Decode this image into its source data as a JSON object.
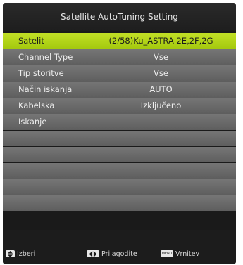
{
  "title": "Satellite AutoTuning Setting",
  "rows": [
    {
      "label": "Satelit",
      "value": "(2/58)Ku_ASTRA 2E,2F,2G",
      "selected": true
    },
    {
      "label": "Channel Type",
      "value": "Vse"
    },
    {
      "label": "Tip storitve",
      "value": "Vse"
    },
    {
      "label": "Način iskanja",
      "value": "AUTO"
    },
    {
      "label": "Kabelska",
      "value": "Izključeno"
    },
    {
      "label": "Iskanje",
      "value": ""
    },
    {
      "label": "",
      "value": ""
    },
    {
      "label": "",
      "value": ""
    },
    {
      "label": "",
      "value": ""
    },
    {
      "label": "",
      "value": ""
    },
    {
      "label": "",
      "value": ""
    }
  ],
  "footer": {
    "select_label": "Izberi",
    "adjust_label": "Prilagodite",
    "menu_key_text": "MENU",
    "back_label": "Vrnitev"
  },
  "colors": {
    "selected_row": "#b3d41a",
    "row_bg": "#6b6b6b",
    "background": "#1a1a1a"
  },
  "icons": {
    "select": "up-down-arrows-icon",
    "adjust": "left-right-arrows-icon",
    "back": "menu-key-icon"
  }
}
